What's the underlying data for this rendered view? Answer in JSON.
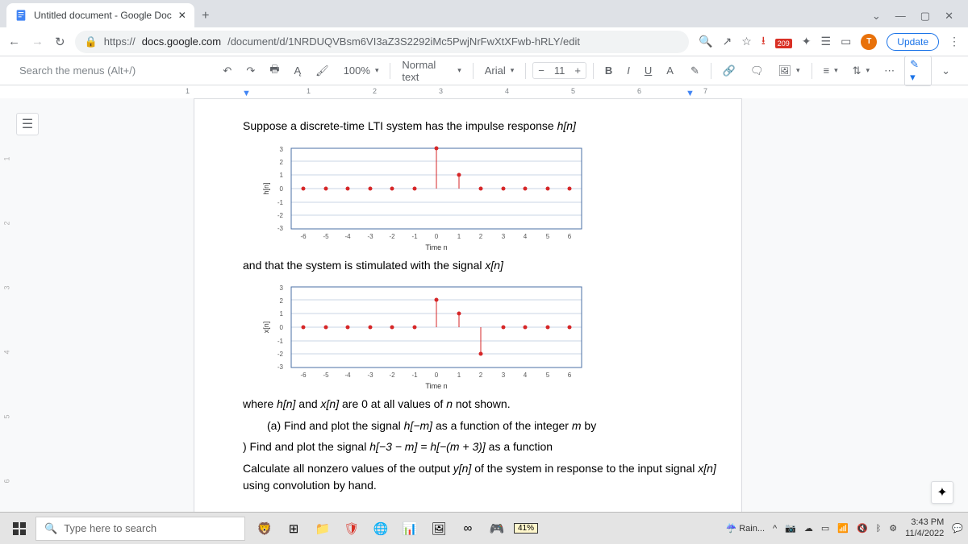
{
  "browser": {
    "tab_title": "Untitled document - Google Doc",
    "url_host": "docs.google.com",
    "url_path": "/document/d/1NRDUQVBsm6VI3aZ3S2292iMc5PwjNrFwXtXFwb-hRLY/edit",
    "update_label": "Update",
    "ext_badge": "209",
    "avatar_letter": "T"
  },
  "toolbar": {
    "menu_search_placeholder": "Search the menus (Alt+/)",
    "zoom": "100%",
    "style": "Normal text",
    "font": "Arial",
    "font_size": "11",
    "bold": "B",
    "italic": "I",
    "underline": "U",
    "color": "A"
  },
  "ruler": {
    "ticks": [
      "1",
      "1",
      "2",
      "3",
      "4",
      "5",
      "6",
      "7"
    ]
  },
  "doc": {
    "p1_a": "Suppose a discrete-time LTI system has the impulse response ",
    "p1_b": "h[n]",
    "p2_a": "and that the system is stimulated with the signal ",
    "p2_b": "x[n]",
    "p3_a": "where ",
    "p3_b": "h[n]",
    "p3_c": " and ",
    "p3_d": "x[n]",
    "p3_e": " are 0 at all values of ",
    "p3_f": "n",
    "p3_g": " not shown.",
    "p4_a": "(a) Find and plot the signal ",
    "p4_b": "h[−m]",
    "p4_c": " as a function of the integer ",
    "p4_d": "m",
    "p4_e": " by",
    "p5_a": ") Find and plot the signal ",
    "p5_b": "h[−3 − m] = h[−(m + 3)]",
    "p5_c": " as a function",
    "p6_a": "Calculate all nonzero values of the output ",
    "p6_b": "y[n]",
    "p6_c": " of the system in response to the input signal ",
    "p6_d": "x[n]",
    "p6_e": " using convolution by hand.",
    "plot_xlabel": "Time n",
    "plot1_ylabel": "h[n]",
    "plot2_ylabel": "x[n]"
  },
  "chart_data": [
    {
      "type": "stem",
      "title": "h[n]",
      "xlabel": "Time n",
      "ylabel": "h[n]",
      "x_range": [
        -6,
        6
      ],
      "y_range": [
        -3,
        3
      ],
      "x": [
        -6,
        -5,
        -4,
        -3,
        -2,
        -1,
        0,
        1,
        2,
        3,
        4,
        5,
        6
      ],
      "y": [
        0,
        0,
        0,
        0,
        0,
        0,
        3,
        1,
        0,
        0,
        0,
        0,
        0
      ]
    },
    {
      "type": "stem",
      "title": "x[n]",
      "xlabel": "Time n",
      "ylabel": "x[n]",
      "x_range": [
        -6,
        6
      ],
      "y_range": [
        -3,
        3
      ],
      "x": [
        -6,
        -5,
        -4,
        -3,
        -2,
        -1,
        0,
        1,
        2,
        3,
        4,
        5,
        6
      ],
      "y": [
        0,
        0,
        0,
        0,
        0,
        0,
        2,
        1,
        -2,
        0,
        0,
        0,
        0
      ]
    }
  ],
  "taskbar": {
    "search_placeholder": "Type here to search",
    "battery": "41%",
    "weather": "Rain...",
    "time": "3:43 PM",
    "date": "11/4/2022"
  }
}
